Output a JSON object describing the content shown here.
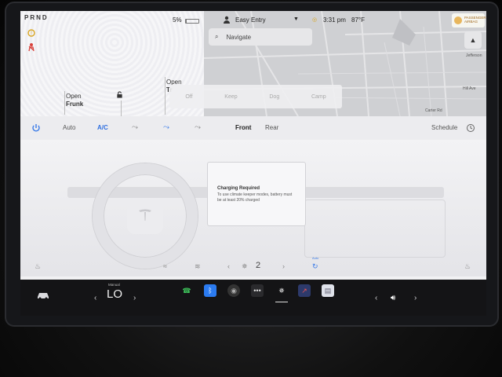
{
  "gear": "PRND",
  "status": {
    "battery_percent": "5%",
    "battery_level": 0.05,
    "profile": "Easy Entry",
    "time": "3:31 pm",
    "temperature": "87°F"
  },
  "airbag": {
    "line1": "PASSENGER",
    "line2": "AIRBAG"
  },
  "map": {
    "search_placeholder": "Navigate",
    "streets": [
      "Jefferson",
      "Hill Ave",
      "Carter Rd"
    ]
  },
  "car": {
    "frunk_open": "Open",
    "frunk_label": "Frunk",
    "trunk_open": "Open",
    "trunk_label": "Tr"
  },
  "modes": [
    "Off",
    "Keep",
    "Dog",
    "Camp"
  ],
  "climate": {
    "auto": "Auto",
    "ac": "A/C",
    "front": "Front",
    "rear": "Rear",
    "schedule": "Schedule"
  },
  "popup": {
    "title": "Charging Required",
    "body": "To use climate keeper modes, battery must be at least 20% charged"
  },
  "fan": {
    "level": "2",
    "auto_label": "Auto"
  },
  "taskbar": {
    "temp_mode": "Manual",
    "temp_value": "LO"
  },
  "colors": {
    "accent": "#2f6fe0",
    "taskbar": "#141416",
    "screen": "#f1f1f3"
  }
}
